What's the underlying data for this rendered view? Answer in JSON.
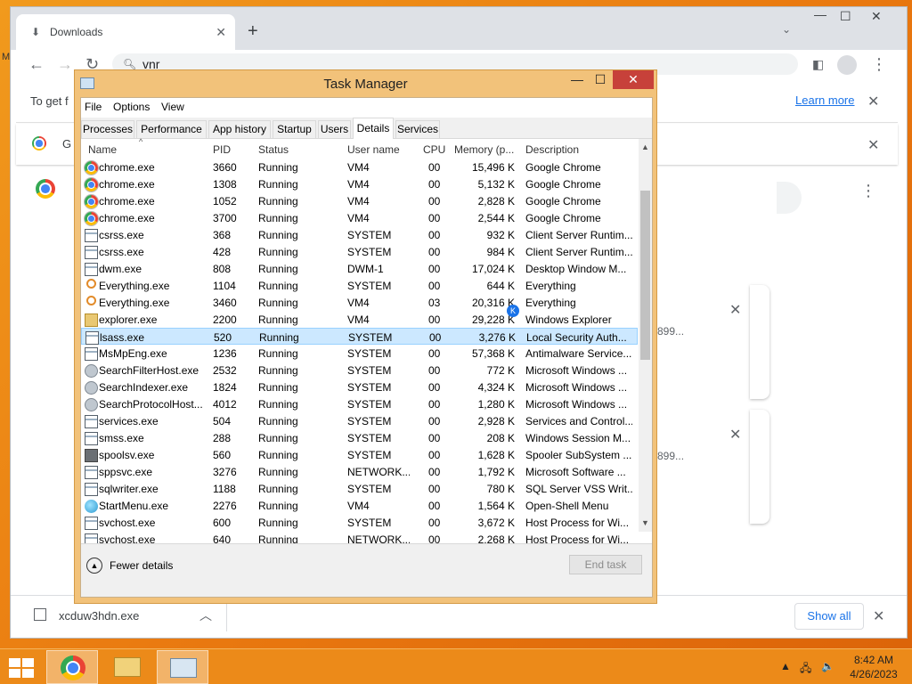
{
  "browser": {
    "tab_title": "Downloads",
    "omnibox_text": "vnr",
    "info_text": "To get f",
    "learn_more": "Learn more",
    "bar2_letter": "G",
    "desktop_letter": "M"
  },
  "cards": [
    {
      "text": "899..."
    },
    {
      "text": "899..."
    }
  ],
  "download_bar": {
    "file_name": "xcduw3hdn.exe",
    "show_all": "Show all"
  },
  "task_manager": {
    "title": "Task Manager",
    "menu": [
      "File",
      "Options",
      "View"
    ],
    "tabs": [
      "Processes",
      "Performance",
      "App history",
      "Startup",
      "Users",
      "Details",
      "Services"
    ],
    "active_tab": "Details",
    "columns": [
      "Name",
      "PID",
      "Status",
      "User name",
      "CPU",
      "Memory (p...",
      "Description"
    ],
    "rows": [
      {
        "icon": "chrome",
        "name": "chrome.exe",
        "pid": "3660",
        "status": "Running",
        "user": "VM4",
        "cpu": "00",
        "mem": "15,496 K",
        "desc": "Google Chrome"
      },
      {
        "icon": "chrome",
        "name": "chrome.exe",
        "pid": "1308",
        "status": "Running",
        "user": "VM4",
        "cpu": "00",
        "mem": "5,132 K",
        "desc": "Google Chrome"
      },
      {
        "icon": "chrome",
        "name": "chrome.exe",
        "pid": "1052",
        "status": "Running",
        "user": "VM4",
        "cpu": "00",
        "mem": "2,828 K",
        "desc": "Google Chrome"
      },
      {
        "icon": "chrome",
        "name": "chrome.exe",
        "pid": "3700",
        "status": "Running",
        "user": "VM4",
        "cpu": "00",
        "mem": "2,544 K",
        "desc": "Google Chrome"
      },
      {
        "icon": "app",
        "name": "csrss.exe",
        "pid": "368",
        "status": "Running",
        "user": "SYSTEM",
        "cpu": "00",
        "mem": "932 K",
        "desc": "Client Server Runtim..."
      },
      {
        "icon": "app",
        "name": "csrss.exe",
        "pid": "428",
        "status": "Running",
        "user": "SYSTEM",
        "cpu": "00",
        "mem": "984 K",
        "desc": "Client Server Runtim..."
      },
      {
        "icon": "app",
        "name": "dwm.exe",
        "pid": "808",
        "status": "Running",
        "user": "DWM-1",
        "cpu": "00",
        "mem": "17,024 K",
        "desc": "Desktop Window M..."
      },
      {
        "icon": "search",
        "name": "Everything.exe",
        "pid": "1104",
        "status": "Running",
        "user": "SYSTEM",
        "cpu": "00",
        "mem": "644 K",
        "desc": "Everything"
      },
      {
        "icon": "search",
        "name": "Everything.exe",
        "pid": "3460",
        "status": "Running",
        "user": "VM4",
        "cpu": "03",
        "mem": "20,316 K",
        "desc": "Everything"
      },
      {
        "icon": "folder",
        "name": "explorer.exe",
        "pid": "2200",
        "status": "Running",
        "user": "VM4",
        "cpu": "00",
        "mem": "29,228 K",
        "desc": "Windows Explorer"
      },
      {
        "icon": "app",
        "name": "lsass.exe",
        "pid": "520",
        "status": "Running",
        "user": "SYSTEM",
        "cpu": "00",
        "mem": "3,276 K",
        "desc": "Local Security Auth...",
        "selected": true
      },
      {
        "icon": "app",
        "name": "MsMpEng.exe",
        "pid": "1236",
        "status": "Running",
        "user": "SYSTEM",
        "cpu": "00",
        "mem": "57,368 K",
        "desc": "Antimalware Service..."
      },
      {
        "icon": "user",
        "name": "SearchFilterHost.exe",
        "pid": "2532",
        "status": "Running",
        "user": "SYSTEM",
        "cpu": "00",
        "mem": "772 K",
        "desc": "Microsoft Windows ..."
      },
      {
        "icon": "user",
        "name": "SearchIndexer.exe",
        "pid": "1824",
        "status": "Running",
        "user": "SYSTEM",
        "cpu": "00",
        "mem": "4,324 K",
        "desc": "Microsoft Windows ..."
      },
      {
        "icon": "user",
        "name": "SearchProtocolHost...",
        "pid": "4012",
        "status": "Running",
        "user": "SYSTEM",
        "cpu": "00",
        "mem": "1,280 K",
        "desc": "Microsoft Windows ..."
      },
      {
        "icon": "app",
        "name": "services.exe",
        "pid": "504",
        "status": "Running",
        "user": "SYSTEM",
        "cpu": "00",
        "mem": "2,928 K",
        "desc": "Services and Control..."
      },
      {
        "icon": "app",
        "name": "smss.exe",
        "pid": "288",
        "status": "Running",
        "user": "SYSTEM",
        "cpu": "00",
        "mem": "208 K",
        "desc": "Windows Session M..."
      },
      {
        "icon": "printer",
        "name": "spoolsv.exe",
        "pid": "560",
        "status": "Running",
        "user": "SYSTEM",
        "cpu": "00",
        "mem": "1,628 K",
        "desc": "Spooler SubSystem ..."
      },
      {
        "icon": "app",
        "name": "sppsvc.exe",
        "pid": "3276",
        "status": "Running",
        "user": "NETWORK...",
        "cpu": "00",
        "mem": "1,792 K",
        "desc": "Microsoft Software ..."
      },
      {
        "icon": "app",
        "name": "sqlwriter.exe",
        "pid": "1188",
        "status": "Running",
        "user": "SYSTEM",
        "cpu": "00",
        "mem": "780 K",
        "desc": "SQL Server VSS Writ..."
      },
      {
        "icon": "globe",
        "name": "StartMenu.exe",
        "pid": "2276",
        "status": "Running",
        "user": "VM4",
        "cpu": "00",
        "mem": "1,564 K",
        "desc": "Open-Shell Menu"
      },
      {
        "icon": "app",
        "name": "svchost.exe",
        "pid": "600",
        "status": "Running",
        "user": "SYSTEM",
        "cpu": "00",
        "mem": "3,672 K",
        "desc": "Host Process for Wi..."
      },
      {
        "icon": "app",
        "name": "svchost.exe",
        "pid": "640",
        "status": "Running",
        "user": "NETWORK...",
        "cpu": "00",
        "mem": "2,268 K",
        "desc": "Host Process for Wi..."
      }
    ],
    "fewer_details": "Fewer details",
    "end_task": "End task"
  },
  "taskbar": {
    "time": "8:42 AM",
    "date": "4/26/2023"
  },
  "colors": {
    "desktop": "#e9780f",
    "taskbar": "#ec8a19",
    "tm_frame": "#f2c27a",
    "close_red": "#c7413a",
    "selection": "#cce8ff",
    "link_blue": "#1a73e8"
  }
}
